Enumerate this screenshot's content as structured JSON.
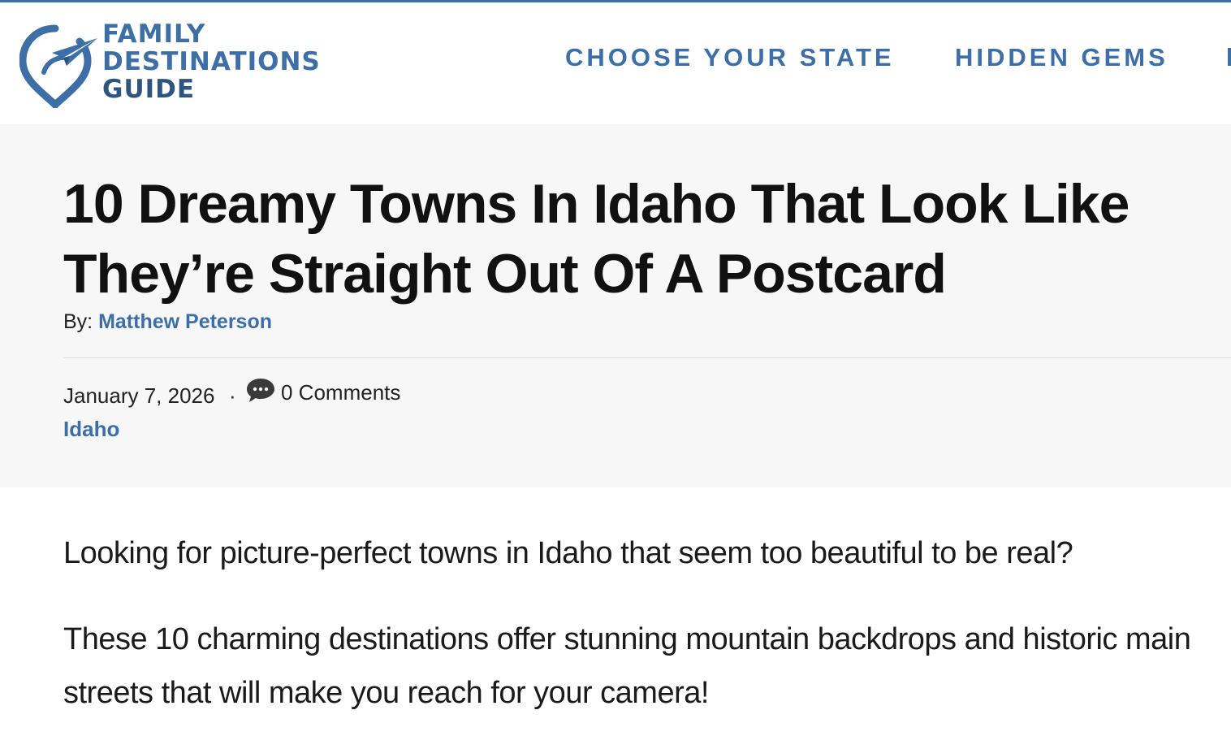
{
  "header": {
    "logo": {
      "line1": "FAMILY",
      "line2": "DESTINATIONS",
      "line3": "GUIDE",
      "icon": "map-pin-paper-plane-icon"
    },
    "nav": [
      {
        "label": "CHOOSE YOUR STATE"
      },
      {
        "label": "HIDDEN GEMS"
      }
    ]
  },
  "article": {
    "title": "10 Dreamy Towns In Idaho That Look Like They’re Straight Out Of A Postcard",
    "byline_prefix": "By:",
    "author": "Matthew Peterson",
    "date": "January 7, 2026",
    "separator": "·",
    "comments": "0 Comments",
    "comment_icon": "speech-bubble-icon",
    "category": "Idaho",
    "paragraphs": [
      "Looking for picture-perfect towns in Idaho that seem too beautiful to be real?",
      "These 10 charming destinations offer stunning mountain backdrops and historic main streets that will make you reach for your camera!"
    ]
  },
  "colors": {
    "brand": "#3d6fa6",
    "hero_bg": "#f7f7f7",
    "text": "#111111"
  }
}
